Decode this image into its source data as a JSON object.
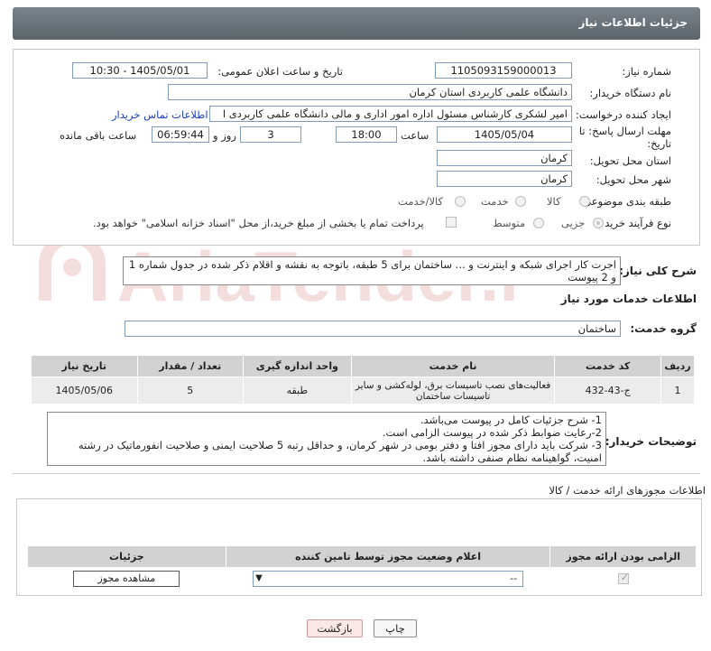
{
  "header": {
    "title": "جزئیات اطلاعات نیاز"
  },
  "form": {
    "need_number_label": "شماره نیاز:",
    "need_number": "1105093159000013",
    "announce_label": "تاریخ و ساعت اعلان عمومی:",
    "announce_value": "1405/05/01 - 10:30",
    "buyer_org_label": "نام دستگاه خریدار:",
    "buyer_org": "دانشگاه علمی کاربردی استان کرمان",
    "creator_label": "ایجاد کننده درخواست:",
    "creator": "امیر لشکری کارشناس مسئول اداره امور اداری و مالی دانشگاه علمی کاربردی ا",
    "contact_link": "اطلاعات تماس خریدار",
    "deadline_label_1": "مهلت ارسال پاسخ: تا",
    "deadline_label_2": "تاریخ:",
    "deadline_date": "1405/05/04",
    "time_label": "ساعت",
    "deadline_time": "18:00",
    "days_value": "3",
    "days_label": "روز و",
    "remaining_time": "06:59:44",
    "remaining_label": "ساعت باقی مانده",
    "province_label": "استان محل تحویل:",
    "province": "کرمان",
    "city_label": "شهر محل تحویل:",
    "city": "کرمان",
    "category_label": "طبقه بندی موضوعی:",
    "category_options": [
      "کالا",
      "خدمت",
      "کالا/خدمت"
    ],
    "process_label": "نوع فرآیند خرید :",
    "process_options": [
      "جزیی",
      "متوسط"
    ],
    "payment_note": "پرداخت تمام یا بخشی از مبلغ خرید،از محل \"اسناد خزانه اسلامی\" خواهد بود."
  },
  "summary": {
    "label": "شرح کلی نیاز:",
    "text": "اجرت کار اجرای شبکه و اینترنت و ... ساختمان برای 5 طبقه، باتوجه به نقشه و اقلام ذکر شده در جدول شماره 1 و 2 پیوست"
  },
  "services": {
    "section_title": "اطلاعات خدمات مورد نیاز",
    "group_label": "گروه خدمت:",
    "group_value": "ساختمان",
    "table": {
      "headers": [
        "ردیف",
        "کد خدمت",
        "نام خدمت",
        "واحد اندازه گیری",
        "تعداد / مقدار",
        "تاریخ نیاز"
      ],
      "rows": [
        [
          "1",
          "ج-43-432",
          "فعالیت‌های نصب تاسیسات برق، لوله‌کشی و سایر تاسیسات ساختمان",
          "طبقه",
          "5",
          "1405/05/06"
        ]
      ]
    }
  },
  "buyer_notes": {
    "label": "توضیحات خریدار:",
    "lines": [
      "1- شرح جزئیات کامل در پیوست می‌باشد.",
      "2-رعایت ضوابط ذکر شده در پیوست الزامی است.",
      "3- شرکت باید دارای مجوز افتا و دفتر بومی در شهر کرمان، و حداقل رتبه 5 صلاحیت ایمنی و صلاحیت انفورماتیک در رشته امنیت، گواهینامه نظام صنفی داشته باشد."
    ]
  },
  "permits": {
    "section_title": "اطلاعات مجوزهای ارائه خدمت / کالا",
    "headers": [
      "الزامی بودن ارائه مجوز",
      "اعلام وضعیت مجوز توسط تامین کننده",
      "جزئیات"
    ],
    "select_value": "--",
    "view_button": "مشاهده مجوز"
  },
  "footer": {
    "print_button": "چاپ",
    "back_button": "بازگشت"
  },
  "watermark": {
    "text": "AriaTender.net"
  }
}
